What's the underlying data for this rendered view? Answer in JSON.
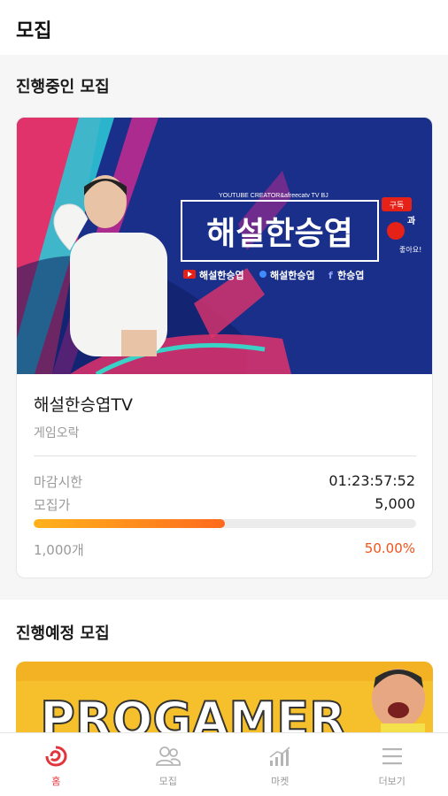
{
  "header": {
    "title": "모집"
  },
  "ongoing": {
    "section_title": "진행중인 모집",
    "card": {
      "banner": {
        "tagline": "YOUTUBE CREATOR&afreecatv TV BJ",
        "headline": "해설한승엽",
        "social_youtube": "해설한승엽",
        "social_afreeca": "해설한승엽",
        "social_facebook": "한승엽",
        "subscribe": "구독",
        "like_text": "과",
        "like_sub": "좋아요!"
      },
      "name": "해설한승엽TV",
      "category": "게임오락",
      "deadline_label": "마감시한",
      "deadline_value": "01:23:57:52",
      "price_label": "모집가",
      "price_value": "5,000",
      "progress_fraction": 0.5,
      "quantity": "1,000개",
      "percent": "50.00%"
    }
  },
  "upcoming": {
    "section_title": "진행예정 모집",
    "banner_text": "PROGAMER"
  },
  "nav": [
    {
      "label": "홈",
      "icon": "home-logo-icon",
      "active": true
    },
    {
      "label": "모집",
      "icon": "people-icon",
      "active": false
    },
    {
      "label": "마켓",
      "icon": "chart-bars-icon",
      "active": false
    },
    {
      "label": "더보기",
      "icon": "menu-icon",
      "active": false
    }
  ],
  "colors": {
    "accent": "#f2531b",
    "progress_start": "#ffb21b",
    "progress_end": "#ff6a1c",
    "nav_active": "#e3343c",
    "banner_bg": "#1a2f8a"
  }
}
